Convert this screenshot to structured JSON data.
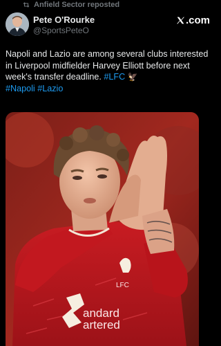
{
  "repost": {
    "label": "Anfield Sector reposted",
    "icon": "repost-icon"
  },
  "author": {
    "name": "Pete O'Rourke",
    "handle": "@SportsPeteO",
    "avatar_icon": "avatar"
  },
  "brand": {
    "label": ".com",
    "icon": "x-logo-icon"
  },
  "tweet": {
    "text": "Napoli and Lazio are among several clubs interested in Liverpool midfielder Harvey Elliott before next week's transfer deadline. ",
    "hashtag_lfc": "#LFC",
    "emoji": "🦅",
    "hashtag_napoli": "#Napoli",
    "hashtag_lazio": "#Lazio"
  },
  "media": {
    "description_icon": "player-photo",
    "shirt_crest_text": "LFC",
    "sponsor_line1": "andard",
    "sponsor_line2": "artered"
  },
  "colors": {
    "background": "#000000",
    "link": "#1d9bf0",
    "secondary": "#71767b",
    "shirt": "#c8102e"
  }
}
